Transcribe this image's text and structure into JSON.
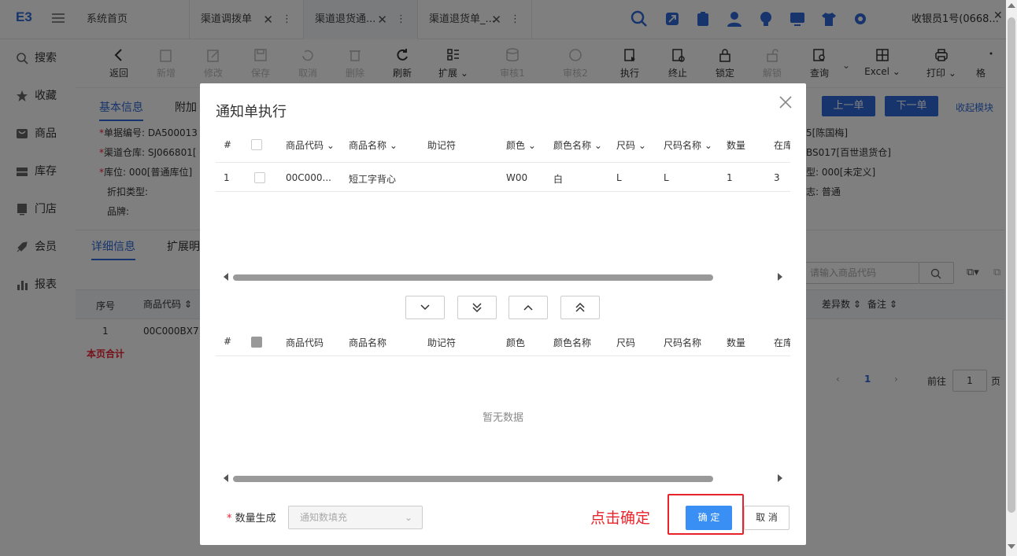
{
  "app": {
    "logo": "E3"
  },
  "tabs": [
    {
      "label": "系统首页"
    },
    {
      "label": "渠道调拨单"
    },
    {
      "label": "渠道退货通..."
    },
    {
      "label": "渠道退货单_..."
    }
  ],
  "user": "收银员1号(0668...",
  "sidebar": [
    {
      "label": "搜索",
      "icon": "search-icon"
    },
    {
      "label": "收藏",
      "icon": "star-icon"
    },
    {
      "label": "商品",
      "icon": "goods-icon"
    },
    {
      "label": "库存",
      "icon": "inventory-icon"
    },
    {
      "label": "门店",
      "icon": "store-icon"
    },
    {
      "label": "会员",
      "icon": "member-icon"
    },
    {
      "label": "报表",
      "icon": "report-icon"
    }
  ],
  "toolbar": [
    {
      "label": "返回",
      "enabled": true
    },
    {
      "label": "新增",
      "enabled": false
    },
    {
      "label": "修改",
      "enabled": false
    },
    {
      "label": "保存",
      "enabled": false
    },
    {
      "label": "取消",
      "enabled": false
    },
    {
      "label": "删除",
      "enabled": false
    },
    {
      "label": "刷新",
      "enabled": true
    },
    {
      "label": "扩展",
      "enabled": true
    },
    {
      "label": "审核1",
      "enabled": false
    },
    {
      "label": "审核2",
      "enabled": false
    },
    {
      "label": "执行",
      "enabled": true
    },
    {
      "label": "终止",
      "enabled": true
    },
    {
      "label": "锁定",
      "enabled": true
    },
    {
      "label": "解锁",
      "enabled": false
    },
    {
      "label": "查询",
      "enabled": true
    },
    {
      "label": "Excel",
      "enabled": true
    },
    {
      "label": "打印",
      "enabled": true
    },
    {
      "label": "格",
      "enabled": true
    }
  ],
  "form": {
    "tab_basic": "基本信息",
    "tab_extra": "附加",
    "prev": "上一单",
    "next": "下一单",
    "collapse": "收起模块",
    "doc_no_label": "单据编号:",
    "doc_no": "DA500013",
    "warehouse_label": "渠道仓库:",
    "warehouse": "SJ066801[",
    "location_label": "库位:",
    "location": "000[普通库位]",
    "discount_label": "折扣类型:",
    "brand_label": "品牌:",
    "right1": "5[陈国梅]",
    "right2": "BS017[百世退货仓]",
    "right3": "型:",
    "right3_val": "000[未定义]",
    "right4": "志:",
    "right4_val": "普通",
    "detail_tab": "详细信息",
    "ext_tab": "扩展明",
    "search_placeholder": "请输入商品代码",
    "col_seq": "序号",
    "col_code": "商品代码",
    "col_diff": "差异数",
    "col_note": "备注",
    "row_seq": "1",
    "row_code": "00C000BX7...",
    "total": "本页合计",
    "page_current": "1",
    "goto_label": "前往",
    "goto_value": "1",
    "page_unit": "页"
  },
  "modal": {
    "title": "通知单执行",
    "columns": [
      "#",
      "商品代码",
      "商品名称",
      "助记符",
      "颜色",
      "颜色名称",
      "尺码",
      "尺码名称",
      "数量",
      "在库"
    ],
    "rows": [
      {
        "index": "1",
        "code": "00C000...",
        "name": "短工字背心",
        "mnemonic": "",
        "color": "W00",
        "color_name": "白",
        "size": "L",
        "size_name": "L",
        "qty": "1",
        "stock": "3"
      }
    ],
    "empty_text": "暂无数据",
    "qty_label": "数量生成",
    "qty_placeholder": "通知数填充",
    "annotation": "点击确定",
    "ok": "确 定",
    "cancel": "取 消"
  }
}
